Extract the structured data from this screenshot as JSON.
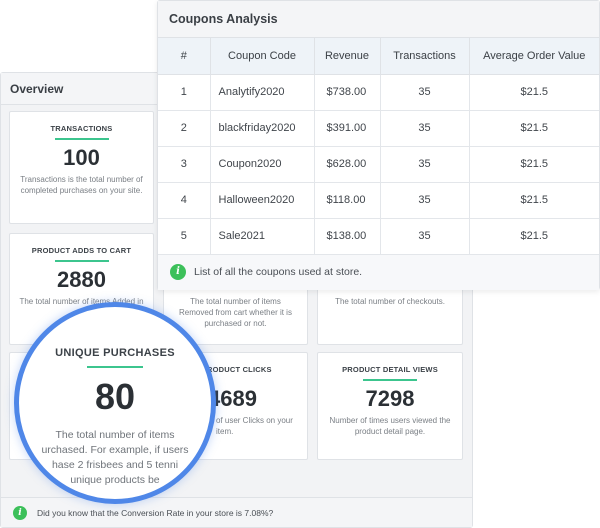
{
  "overview": {
    "title": "Overview",
    "cards": [
      {
        "title": "TRANSACTIONS",
        "value": "100",
        "desc": "Transactions is the total number of completed purchases on your site."
      },
      {
        "title": "PRODUCT ADDS TO CART",
        "value": "2880",
        "desc": "The total number of items Added in"
      },
      {
        "title": "",
        "value": "",
        "desc": "The total number of items Removed from cart whether it is purchased or not."
      },
      {
        "title": "",
        "value": "",
        "desc": "The total number of checkouts."
      },
      {
        "title": "",
        "value": "",
        "desc": ""
      },
      {
        "title": "RODUCT CLICKS",
        "value": "4689",
        "desc": "of user Clicks on your item."
      },
      {
        "title": "PRODUCT DETAIL VIEWS",
        "value": "7298",
        "desc": "Number of times users viewed the product detail page."
      }
    ],
    "footer": "Did you know that the Conversion Rate in your store is 7.08%?"
  },
  "coupons": {
    "title": "Coupons Analysis",
    "columns": [
      "#",
      "Coupon Code",
      "Revenue",
      "Transactions",
      "Average Order Value"
    ],
    "rows": [
      [
        "1",
        "Analytify2020",
        "$738.00",
        "35",
        "$21.5"
      ],
      [
        "2",
        "blackfriday2020",
        "$391.00",
        "35",
        "$21.5"
      ],
      [
        "3",
        "Coupon2020",
        "$628.00",
        "35",
        "$21.5"
      ],
      [
        "4",
        "Halloween2020",
        "$118.00",
        "35",
        "$21.5"
      ],
      [
        "5",
        "Sale2021",
        "$138.00",
        "35",
        "$21.5"
      ]
    ],
    "footer": "List of all the coupons used at store."
  },
  "magnifier": {
    "title": "UNIQUE PURCHASES",
    "value": "80",
    "desc_lines": [
      "The total number of items",
      "urchased. For example, if users",
      "hase 2 frisbees and 5 tenni",
      "unique products be"
    ]
  },
  "icons": {
    "info": "info-icon"
  },
  "colors": {
    "accent_line": "#3cc58e",
    "info_green": "#3cc05a",
    "magnifier_ring": "#4f87e8"
  }
}
